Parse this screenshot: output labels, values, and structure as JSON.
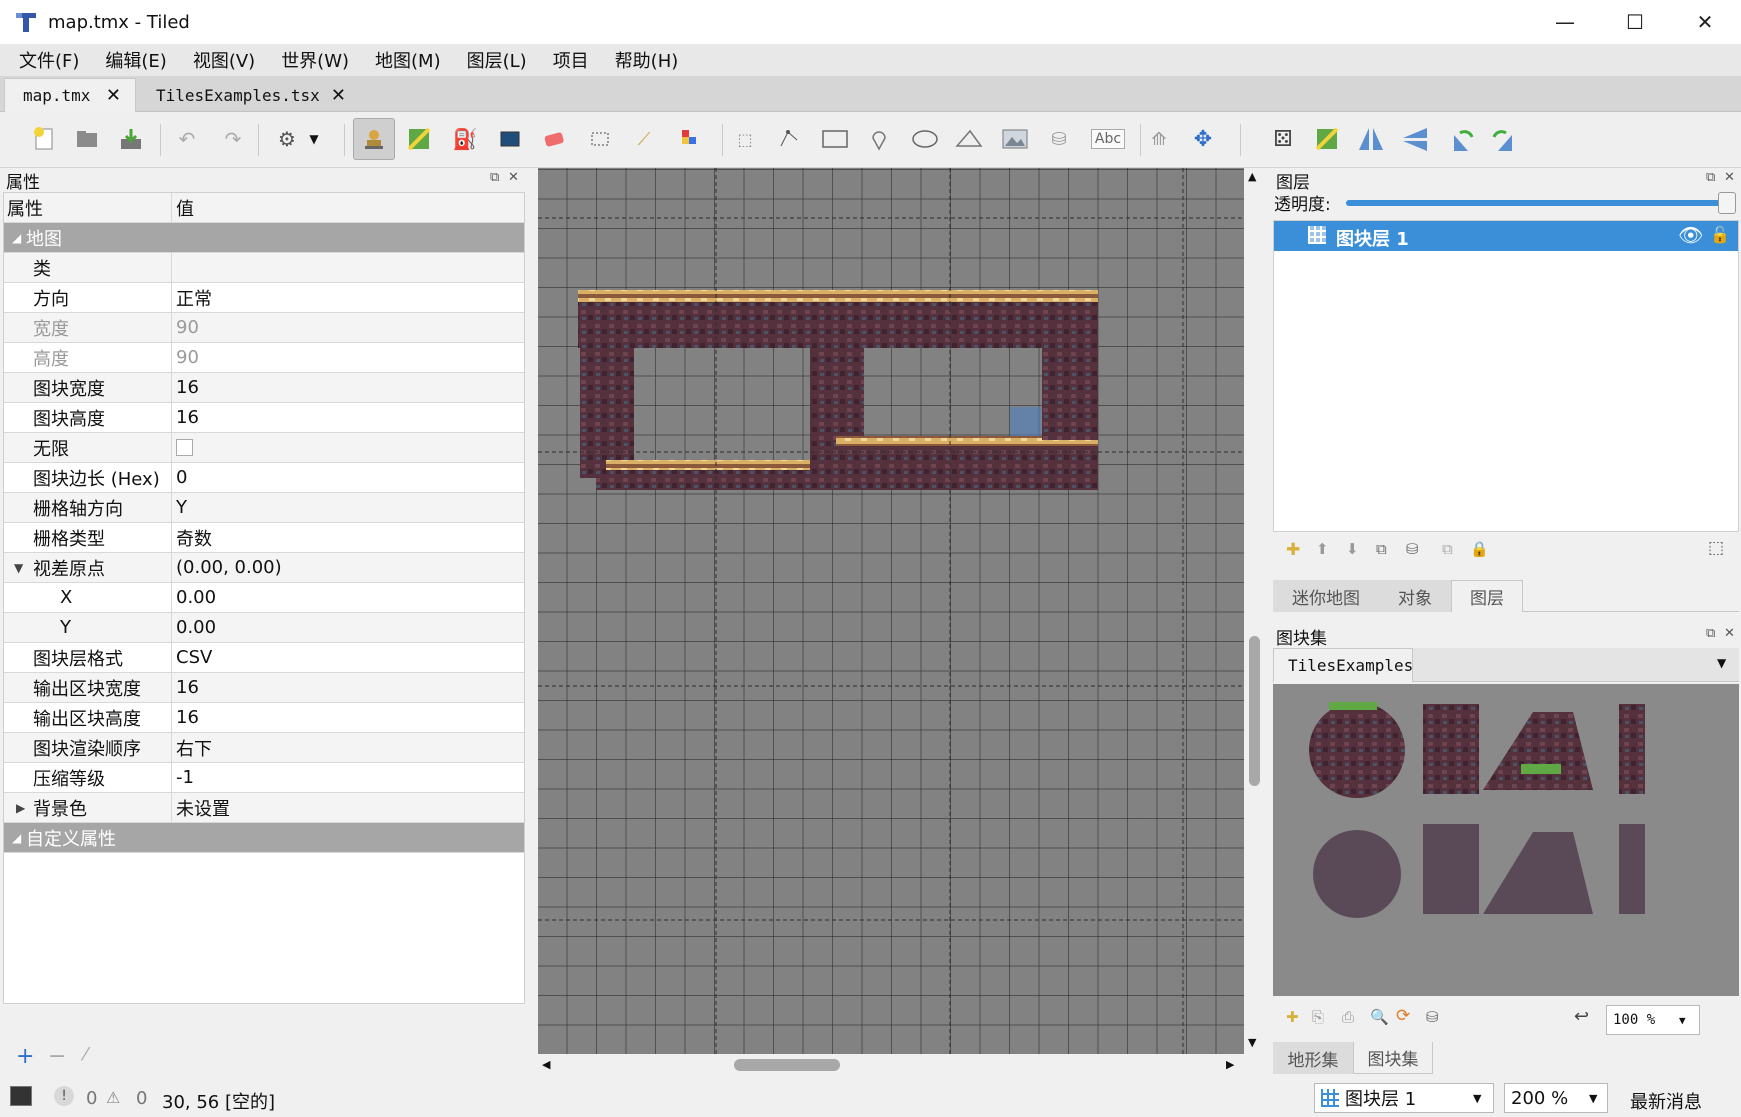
{
  "window": {
    "title": "map.tmx - Tiled",
    "minimize": "—",
    "maximize": "☐",
    "close": "✕"
  },
  "menu": [
    "文件(F)",
    "编辑(E)",
    "视图(V)",
    "世界(W)",
    "地图(M)",
    "图层(L)",
    "项目",
    "帮助(H)"
  ],
  "tabs": [
    {
      "label": "map.tmx",
      "active": true
    },
    {
      "label": "TilesExamples.tsx",
      "active": false
    }
  ],
  "toolbar": {
    "icons": [
      "new-map-icon",
      "open-icon",
      "save-icon",
      "undo-icon",
      "redo-icon",
      "command-icon",
      "stamp-brush-icon",
      "terrain-brush-icon",
      "bucket-fill-icon",
      "shape-fill-icon",
      "eraser-icon",
      "rect-select-icon",
      "magic-wand-icon",
      "select-same-tile-icon",
      "select-objects-icon",
      "edit-polygons-icon",
      "insert-rectangle-icon",
      "insert-point-icon",
      "insert-ellipse-icon",
      "insert-polygon-icon",
      "insert-tile-icon",
      "insert-template-icon",
      "insert-text-icon",
      "world-tool-icon",
      "move-icon",
      "random-mode-icon",
      "wang-fill-icon",
      "flip-horizontal-icon",
      "flip-vertical-icon",
      "rotate-left-icon",
      "rotate-right-icon"
    ],
    "text_tool_label": "Abc"
  },
  "properties": {
    "panel_title": "属性",
    "col_property": "属性",
    "col_value": "值",
    "group_map": "地图",
    "rows": [
      {
        "key": "类",
        "value": ""
      },
      {
        "key": "方向",
        "value": "正常"
      },
      {
        "key": "宽度",
        "value": "90"
      },
      {
        "key": "高度",
        "value": "90"
      },
      {
        "key": "图块宽度",
        "value": "16"
      },
      {
        "key": "图块高度",
        "value": "16"
      },
      {
        "key": "无限",
        "value": ""
      },
      {
        "key": "图块边长 (Hex)",
        "value": "0"
      },
      {
        "key": "栅格轴方向",
        "value": "Y"
      },
      {
        "key": "栅格类型",
        "value": "奇数"
      },
      {
        "key": "视差原点",
        "value": "(0.00, 0.00)"
      },
      {
        "key": "X",
        "value": "0.00"
      },
      {
        "key": "Y",
        "value": "0.00"
      },
      {
        "key": "图块层格式",
        "value": "CSV"
      },
      {
        "key": "输出区块宽度",
        "value": "16"
      },
      {
        "key": "输出区块高度",
        "value": "16"
      },
      {
        "key": "图块渲染顺序",
        "value": "右下"
      },
      {
        "key": "压缩等级",
        "value": "-1"
      },
      {
        "key": "背景色",
        "value": "未设置"
      }
    ],
    "group_custom": "自定义属性"
  },
  "layers": {
    "panel_title": "图层",
    "opacity_label": "透明度:",
    "opacity": 1.0,
    "items": [
      {
        "name": "图块层 1",
        "selected": true,
        "visible": true
      }
    ],
    "bottom_tabs": [
      "迷你地图",
      "对象",
      "图层"
    ],
    "active_tab": "图层"
  },
  "tilesets": {
    "panel_title": "图块集",
    "tabs": [
      "TilesExamples"
    ],
    "zoom": "100 %",
    "bottom_tabs": [
      "地形集",
      "图块集"
    ]
  },
  "status": {
    "errors": "0",
    "warnings": "0",
    "cursor": "30, 56 [空的]",
    "layer": "图块层 1",
    "zoom": "200 %",
    "news": "最新消息"
  },
  "colors": {
    "accent": "#3b8fd9",
    "map_bg": "#828282",
    "group_row": "#a6a6a6",
    "tile_dark": "#5b3642",
    "tile_top": "#e9c77b"
  }
}
